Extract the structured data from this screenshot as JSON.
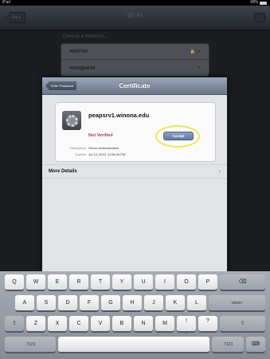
{
  "status": {
    "carrier": "iPad",
    "battery": "49%"
  },
  "nav": {
    "title": "Wi-Fi",
    "back_label": "Back"
  },
  "networks": {
    "header": "Choose a Network...",
    "items": [
      {
        "name": "warrior",
        "icons": "🔒 ▾"
      },
      {
        "name": "wsuguest",
        "icons": "▾"
      }
    ]
  },
  "modal": {
    "title": "Certificate",
    "enter_password": "Enter Password",
    "host": "peapsrv1.winona.edu",
    "status": "Not Verified",
    "accept": "Accept",
    "description_label": "Description",
    "description_value": "Server Authentication",
    "expires_label": "Expires",
    "expires_value": "Jul 13, 2013, 11:56:34 PM",
    "more_details": "More Details",
    "chevron": "›"
  },
  "keyboard": {
    "row1": [
      "Q",
      "W",
      "E",
      "R",
      "T",
      "Y",
      "U",
      "I",
      "O",
      "P"
    ],
    "row2": [
      "A",
      "S",
      "D",
      "F",
      "G",
      "H",
      "J",
      "K",
      "L"
    ],
    "row3": [
      "Z",
      "X",
      "C",
      "V",
      "B",
      "N",
      "M",
      "!",
      "?"
    ],
    "backspace": "⌫",
    "return": "return",
    "shift": "⇧",
    "numbers": ".?123",
    "keyboard_icon": "⌨",
    "punct1": ",",
    "punct2": "."
  },
  "colors": {
    "accent_highlight": "#e9ec3c",
    "not_verified": "#c0323a"
  }
}
